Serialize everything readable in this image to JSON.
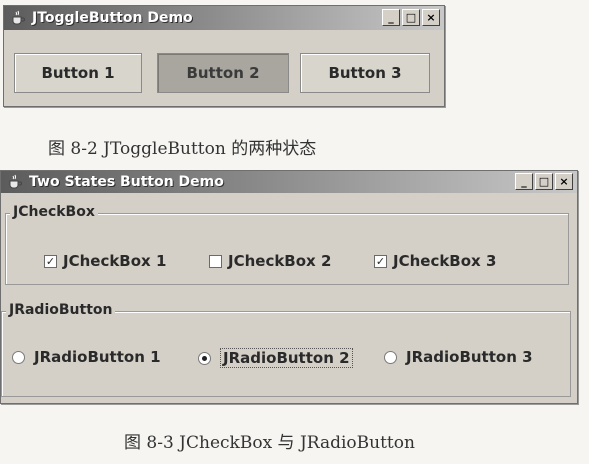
{
  "toggle_window": {
    "title": "JToggleButton Demo",
    "icon": "java-cup-icon",
    "controls": {
      "minimize": "_",
      "maximize": "□",
      "close": "×"
    },
    "buttons": [
      {
        "label": "Button 1",
        "selected": false
      },
      {
        "label": "Button 2",
        "selected": true
      },
      {
        "label": "Button 3",
        "selected": false
      }
    ]
  },
  "caption_1": "图 8-2   JToggleButton 的两种状态",
  "states_window": {
    "title": "Two States Button Demo",
    "icon": "java-cup-icon",
    "controls": {
      "minimize": "_",
      "maximize": "□",
      "close": "×"
    },
    "checkbox_group": {
      "title": "JCheckBox",
      "items": [
        {
          "label": "JCheckBox 1",
          "checked": true
        },
        {
          "label": "JCheckBox 2",
          "checked": false
        },
        {
          "label": "JCheckBox 3",
          "checked": true
        }
      ]
    },
    "radio_group": {
      "title": "JRadioButton",
      "items": [
        {
          "label": "JRadioButton 1",
          "selected": false
        },
        {
          "label": "JRadioButton 2",
          "selected": true
        },
        {
          "label": "JRadioButton 3",
          "selected": false
        }
      ]
    }
  },
  "caption_2": "图 8-3   JCheckBox 与 JRadioButton"
}
